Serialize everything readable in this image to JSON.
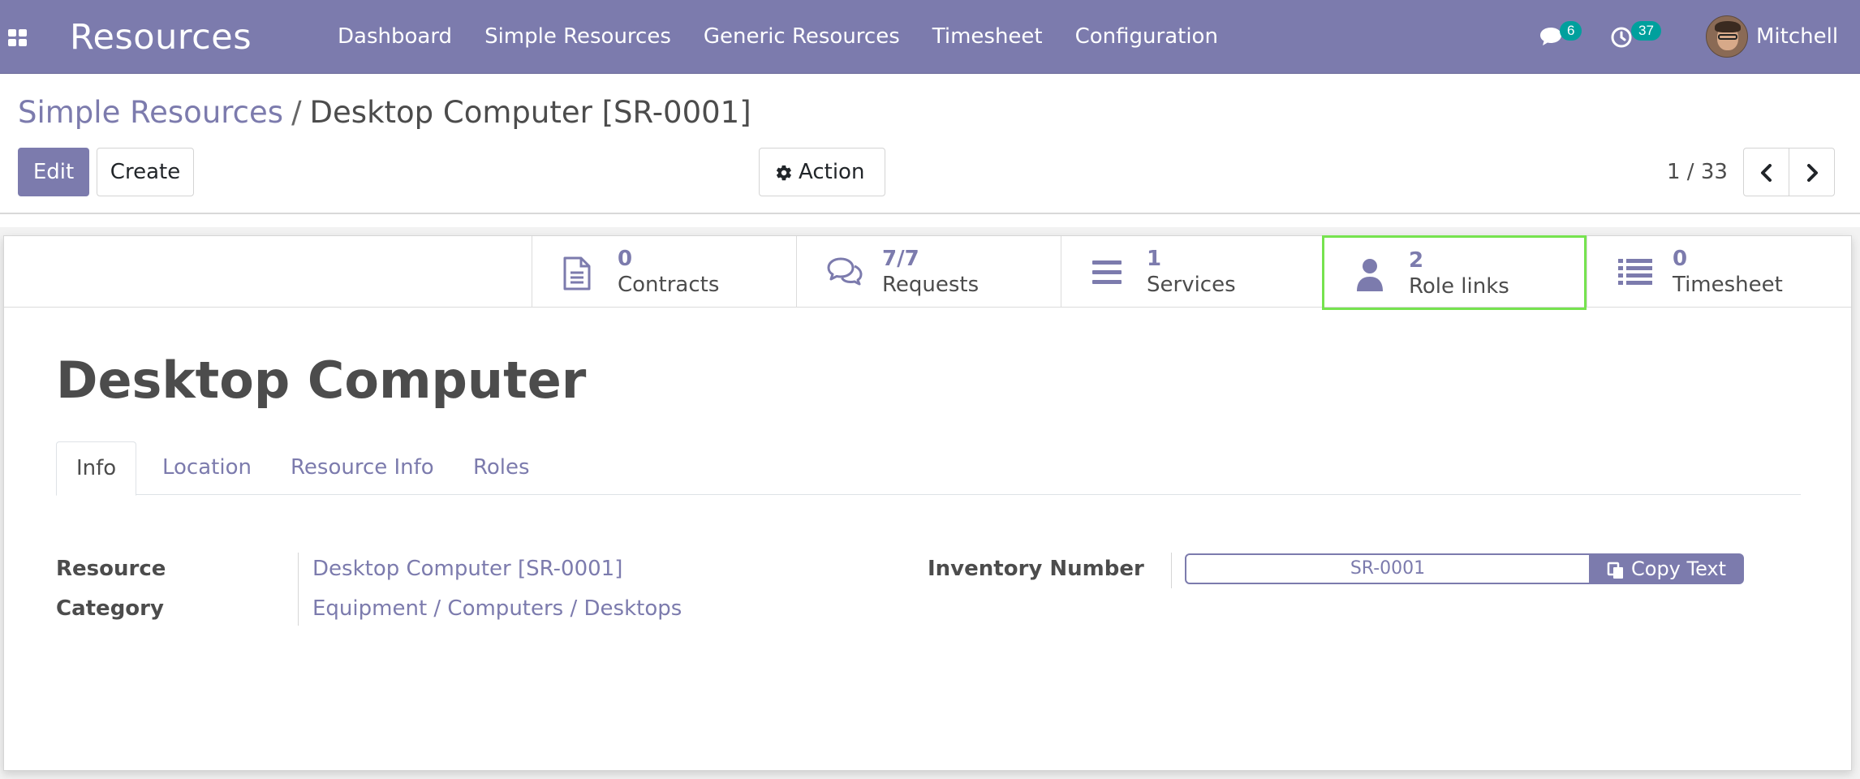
{
  "navbar": {
    "app_title": "Resources",
    "menu": [
      "Dashboard",
      "Simple Resources",
      "Generic Resources",
      "Timesheet",
      "Configuration"
    ],
    "messages_count": "6",
    "activities_count": "37",
    "user_name": "Mitchell",
    "badge_color": "#00a09d",
    "bar_color": "#7c7bad"
  },
  "breadcrumb": {
    "parent": "Simple Resources",
    "separator": "/",
    "current": "Desktop Computer [SR-0001]"
  },
  "controls": {
    "edit_label": "Edit",
    "create_label": "Create",
    "action_label": "Action",
    "pager_value": "1 / 33"
  },
  "stat_buttons": [
    {
      "value": "0",
      "label": "Contracts",
      "icon": "file-icon"
    },
    {
      "value": "7/7",
      "label": "Requests",
      "icon": "comments-icon"
    },
    {
      "value": "1",
      "label": "Services",
      "icon": "bars-icon"
    },
    {
      "value": "2",
      "label": "Role links",
      "icon": "user-icon"
    },
    {
      "value": "0",
      "label": "Timesheet",
      "icon": "list-icon"
    }
  ],
  "record": {
    "title": "Desktop Computer"
  },
  "tabs": [
    "Info",
    "Location",
    "Resource Info",
    "Roles"
  ],
  "fields": {
    "resource_label": "Resource",
    "resource_value": "Desktop Computer [SR-0001]",
    "category_label": "Category",
    "category_value": "Equipment / Computers / Desktops",
    "inventory_label": "Inventory Number",
    "inventory_value": "SR-0001",
    "copy_label": "Copy Text"
  }
}
